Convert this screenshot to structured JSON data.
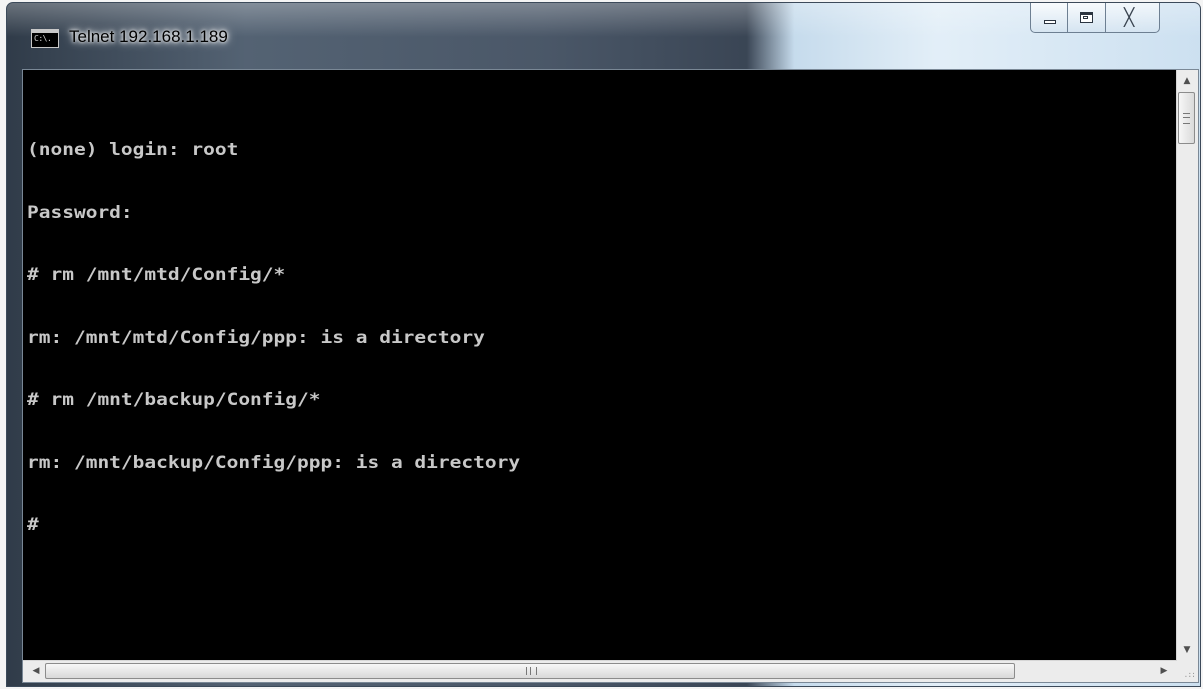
{
  "window": {
    "title": "Telnet 192.168.1.189",
    "icon_label": "C:\\.",
    "icon": "console-icon",
    "caption_buttons": {
      "minimize": "minimize-icon",
      "maximize": "maximize-icon",
      "close": "close-icon",
      "close_glyph": "╳"
    }
  },
  "console": {
    "lines": [
      "(none) login: root",
      "Password:",
      "# rm /mnt/mtd/Config/*",
      "rm: /mnt/mtd/Config/ppp: is a directory",
      "# rm /mnt/backup/Config/*",
      "rm: /mnt/backup/Config/ppp: is a directory",
      "#"
    ],
    "colors": {
      "background": "#000000",
      "text": "#c8c8c8"
    }
  },
  "scrollbars": {
    "up_arrow": "▲",
    "down_arrow": "▼",
    "left_arrow": "◀",
    "right_arrow": "▶"
  }
}
